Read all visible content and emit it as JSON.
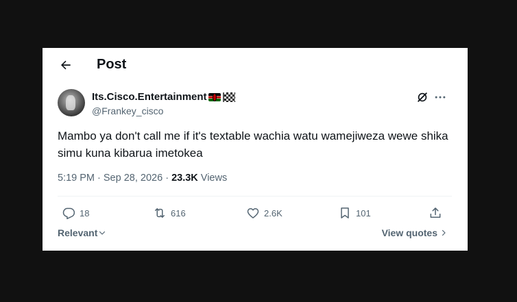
{
  "header": {
    "title": "Post",
    "back_icon": "arrow-left-icon"
  },
  "author": {
    "display_name": "Its.Cisco.Entertainment",
    "emoji_flags": [
      "kenya-flag",
      "checkered-flag"
    ],
    "handle": "@Frankey_cisco"
  },
  "tweet": {
    "text": "Mambo ya don't call me if it's textable wachia watu wamejiweza wewe shika simu kuna kibarua imetokea",
    "time": "5:19 PM",
    "separator": "·",
    "date": "Sep 28, 2026",
    "views_count": "23.3K",
    "views_label": "Views"
  },
  "actions": {
    "reply": {
      "icon": "reply-icon",
      "count": "18"
    },
    "retweet": {
      "icon": "retweet-icon",
      "count": "616"
    },
    "like": {
      "icon": "heart-icon",
      "count": "2.6K"
    },
    "bookmark": {
      "icon": "bookmark-icon",
      "count": "101"
    },
    "share": {
      "icon": "share-icon"
    }
  },
  "footer": {
    "sort_label": "Relevant",
    "view_quotes_label": "View quotes"
  },
  "colors": {
    "background": "#111111",
    "card": "#ffffff",
    "text_primary": "#0f1419",
    "text_secondary": "#536471",
    "divider": "#eff3f4"
  }
}
